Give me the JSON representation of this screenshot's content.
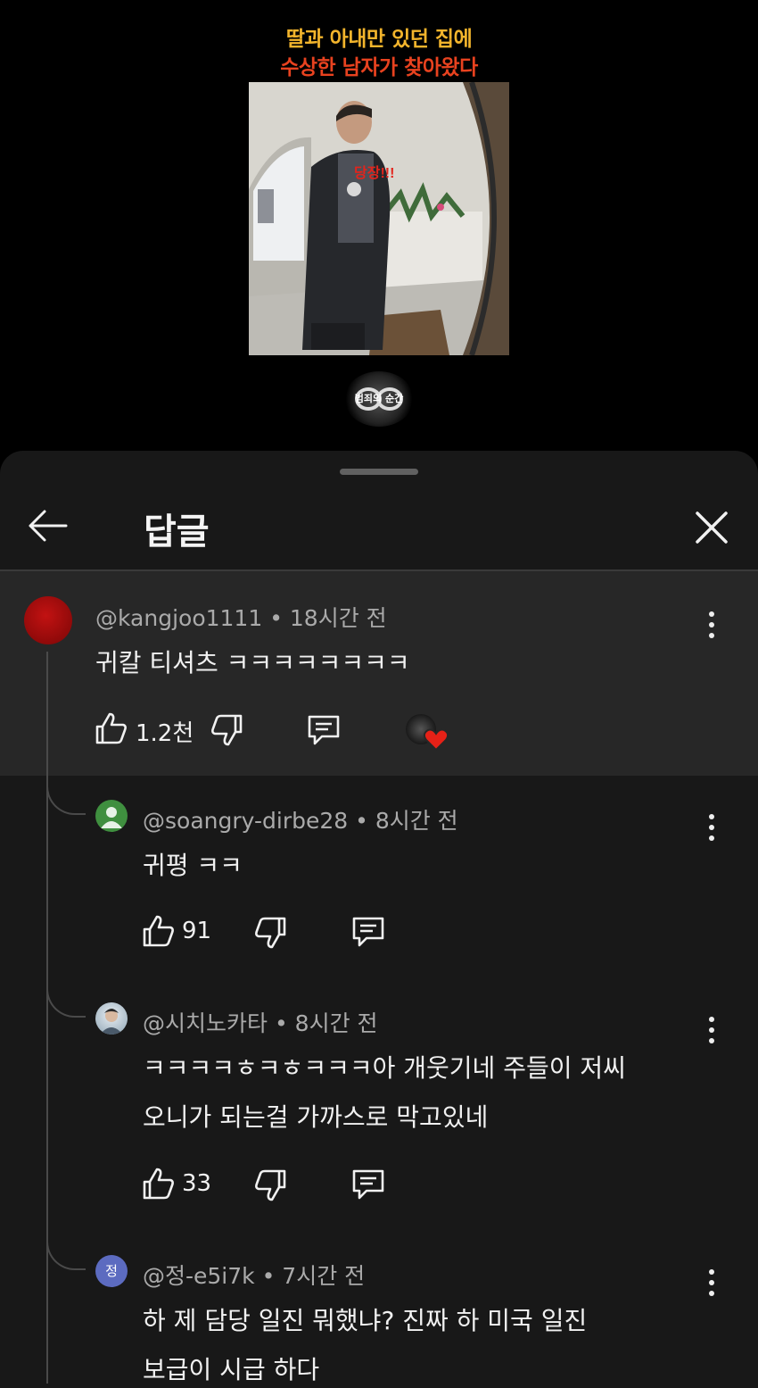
{
  "video": {
    "title_line1": "딸과 아내만 있던 집에",
    "title_line2": "수상한 남자가 찾아왔다",
    "overlay_caption": "당장!!!",
    "channel_logo_text": "범죄의 순간"
  },
  "header": {
    "title": "답글",
    "back_icon": "arrow-left-icon",
    "close_icon": "close-icon"
  },
  "parent_comment": {
    "author": "@kangjoo1111",
    "time": "18시간 전",
    "text": "귀칼 티셔츠 ㅋㅋㅋㅋㅋㅋㅋㅋ",
    "likes": "1.2천",
    "avatar_color": "#b30d0d"
  },
  "replies": [
    {
      "author": "@soangry-dirbe28",
      "time": "8시간 전",
      "lines": [
        "귀평 ㅋㅋ"
      ],
      "likes": "91",
      "avatar_color": "#3f8f3f"
    },
    {
      "author": "@시치노카타",
      "time": "8시간 전",
      "lines": [
        "ㅋㅋㅋㅋㅎㅋㅎㅋㅋㅋ아 개웃기네 주들이 저씨",
        "오니가 되는걸 가까스로 막고있네"
      ],
      "likes": "33",
      "avatar_color": "#9fb3c2"
    },
    {
      "author": "@정-e5i7k",
      "time": "7시간 전",
      "lines": [
        "하 제 담당 일진 뭐했냐? 진짜 하 미국 일진",
        "보급이 시급 하다"
      ],
      "avatar_letter": "정",
      "avatar_color": "#5c6bc0"
    }
  ],
  "separator": "•",
  "colors": {
    "sheet_bg": "#181818",
    "highlight_bg": "#272727",
    "meta_text": "#aaaaaa",
    "heart": "#e62117"
  }
}
